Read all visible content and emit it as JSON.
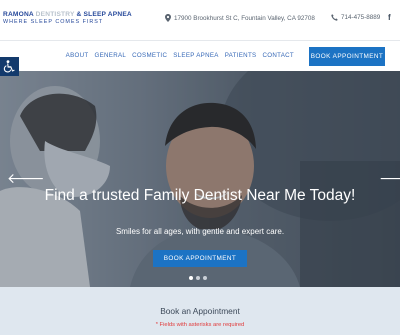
{
  "header": {
    "logo": {
      "line1_part1": "RAMONA",
      "line1_part2": "DENTISTRY",
      "line1_part3": "& SLEEP APNEA",
      "tagline": "WHERE SLEEP COMES FIRST"
    },
    "address": "17900 Brookhurst St C, Fountain Valley, CA 92708",
    "phone": "714-475-8889",
    "social_icon": "f"
  },
  "nav": {
    "links": [
      {
        "label": "ABOUT"
      },
      {
        "label": "GENERAL"
      },
      {
        "label": "COSMETIC"
      },
      {
        "label": "SLEEP APNEA"
      },
      {
        "label": "PATIENTS"
      },
      {
        "label": "CONTACT"
      }
    ],
    "cta": "BOOK APPOINTMENT"
  },
  "hero": {
    "title": "Find a trusted Family Dentist Near Me Today!",
    "subtitle": "Smiles for all ages, with gentle and expert care.",
    "cta": "BOOK APPOINTMENT",
    "prev_arrow": "🡐",
    "next_arrow": "🡒",
    "slide_count": 3,
    "active_slide": 1
  },
  "appointment": {
    "title": "Book an Appointment",
    "note": "* Fields with asterisks are required"
  }
}
